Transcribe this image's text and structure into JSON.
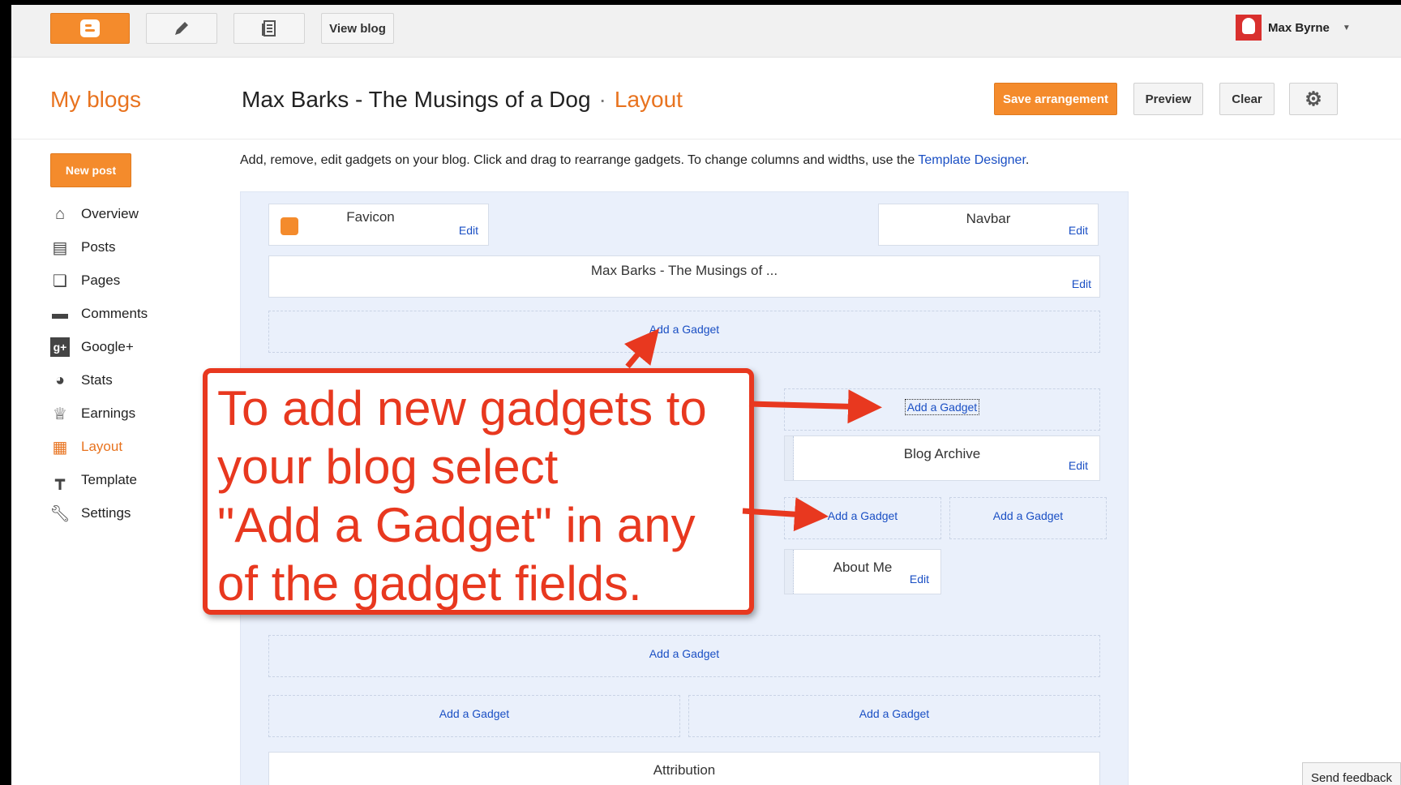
{
  "topbar": {
    "view_blog": "View blog",
    "user_name": "Max Byrne"
  },
  "header": {
    "my_blogs": "My blogs",
    "blog_title": "Max Barks - The Musings of a Dog",
    "separator": "·",
    "section": "Layout",
    "save": "Save arrangement",
    "preview": "Preview",
    "clear": "Clear"
  },
  "sidebar": {
    "new_post": "New post",
    "items": [
      {
        "label": "Overview",
        "icon": "home-icon"
      },
      {
        "label": "Posts",
        "icon": "posts-icon"
      },
      {
        "label": "Pages",
        "icon": "pages-icon"
      },
      {
        "label": "Comments",
        "icon": "comments-icon"
      },
      {
        "label": "Google+",
        "icon": "google-plus-icon"
      },
      {
        "label": "Stats",
        "icon": "stats-icon"
      },
      {
        "label": "Earnings",
        "icon": "trophy-icon"
      },
      {
        "label": "Layout",
        "icon": "layout-icon"
      },
      {
        "label": "Template",
        "icon": "paint-roller-icon"
      },
      {
        "label": "Settings",
        "icon": "wrench-icon"
      }
    ],
    "active": "Layout"
  },
  "main": {
    "description": "Add, remove, edit gadgets on your blog. Click and drag to rearrange gadgets. To change columns and widths, use the ",
    "template_link": "Template Designer",
    "description_end": ".",
    "edit": "Edit",
    "add_gadget": "Add a Gadget",
    "gadgets": {
      "favicon": "Favicon",
      "navbar": "Navbar",
      "header": "Max Barks - The Musings of ...",
      "blog_archive": "Blog Archive",
      "about_me": "About Me",
      "attribution": "Attribution"
    }
  },
  "annotation": {
    "lines": [
      "To add new gadgets to",
      "your blog select",
      "\"Add a Gadget\" in any",
      "of the gadget fields."
    ]
  },
  "feedback": "Send feedback",
  "colors": {
    "accent": "#f48b2c",
    "link": "#1a4fc4",
    "annotation": "#e8381f"
  }
}
